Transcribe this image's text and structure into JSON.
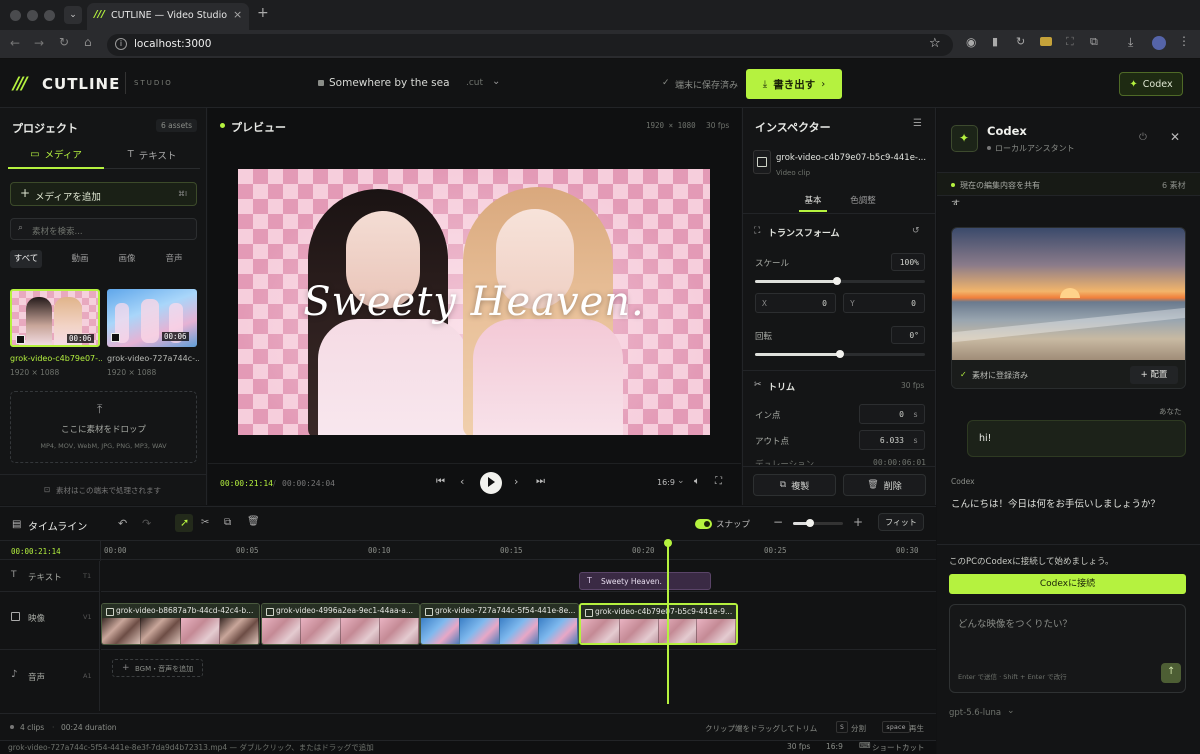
{
  "browser": {
    "tab_title": "CUTLINE — Video Studio",
    "url": "localhost:3000"
  },
  "header": {
    "brand": "CUTLINE",
    "brand_sub": "STUDIO",
    "project_name": "Somewhere by the sea",
    "project_ext": ".cut",
    "save_status": "端末に保存済み",
    "export_label": "書き出す",
    "codex_button": "Codex"
  },
  "project_panel": {
    "title": "プロジェクト",
    "asset_count": "6 assets",
    "tab_media": "メディア",
    "tab_text": "テキスト",
    "add_media": "メディアを追加",
    "add_shortcut": "⌘I",
    "search_placeholder": "素材を検索...",
    "filters": [
      "すべて",
      "動画",
      "画像",
      "音声"
    ],
    "assets": [
      {
        "name": "grok-video-c4b79e07-...",
        "duration": "00:06",
        "res": "1920 × 1088"
      },
      {
        "name": "grok-video-727a744c-...",
        "duration": "00:06",
        "res": "1920 × 1088"
      }
    ],
    "drop_title": "ここに素材をドロップ",
    "drop_formats": "MP4, MOV, WebM, JPG, PNG, MP3, WAV",
    "local_note": "素材はこの端末で処理されます"
  },
  "preview": {
    "title": "プレビュー",
    "resolution": "1920 × 1080",
    "fps": "30 fps",
    "overlay_text": "Sweety Heaven.",
    "current_time": "00:00:21:14",
    "total_time": "00:00:24:04",
    "aspect": "16:9"
  },
  "inspector": {
    "title": "インスペクター",
    "clip_name": "grok-video-c4b79e07-b5c9-441e-...",
    "clip_type": "Video clip",
    "tab_basic": "基本",
    "tab_color": "色調整",
    "transform_title": "トランスフォーム",
    "scale_label": "スケール",
    "scale_value": "100%",
    "scale_fraction": 0.48,
    "x_label": "X",
    "x_value": "0",
    "y_label": "Y",
    "y_value": "0",
    "rotate_label": "回転",
    "rotate_value": "0°",
    "rotate_fraction": 0.5,
    "trim_title": "トリム",
    "trim_fps": "30 fps",
    "in_label": "イン点",
    "in_value": "0",
    "in_unit": "s",
    "out_label": "アウト点",
    "out_value": "6.033",
    "out_unit": "s",
    "duration_label": "デュレーション",
    "duration_value": "00:00:06:01",
    "duplicate": "複製",
    "delete": "削除"
  },
  "codex": {
    "title": "Codex",
    "subtitle": "ローカルアシスタント",
    "share_label": "現在の編集内容を共有",
    "share_count": "6 素材",
    "cut_text": "す。",
    "registered": "素材に登録済み",
    "place": "配置",
    "user_label": "あなた",
    "user_msg": "hi!",
    "bot_label": "Codex",
    "bot_msg": "こんにちは！今日は何をお手伝いしましょうか？",
    "connect_prompt": "このPCのCodexに接続して始めましょう。",
    "connect_button": "Codexに接続",
    "input_placeholder": "どんな映像をつくりたい？",
    "input_hint": "Enter で送信 · Shift + Enter で改行",
    "model": "gpt-5.6-luna"
  },
  "timeline": {
    "title": "タイムライン",
    "snap_label": "スナップ",
    "fit_label": "フィット",
    "current_time": "00:00:21:14",
    "ruler": [
      "00:00",
      "00:05",
      "00:10",
      "00:15",
      "00:20",
      "00:25",
      "00:30"
    ],
    "track_text": "テキスト",
    "track_text_id": "T1",
    "track_video": "映像",
    "track_video_id": "V1",
    "track_audio": "音声",
    "track_audio_id": "A1",
    "text_clip": "Sweety Heaven.",
    "video_clips": [
      "grok-video-b8687a7b-44cd-42c4-b...",
      "grok-video-4996a2ea-9ec1-44aa-a...",
      "grok-video-727a744c-5f54-441e-8e...",
      "grok-video-c4b79e07-b5c9-441e-9..."
    ],
    "add_bgm": "BGM・音声を追加"
  },
  "status": {
    "clips": "4 clips",
    "duration": "00:24 duration",
    "trim_hint": "クリップ端をドラッグしてトリム",
    "split_key": "S",
    "split_label": "分割",
    "play_key": "space",
    "play_label": "再生",
    "file_hint": "grok-video-727a744c-5f54-441e-8e3f-7da9d4b72313.mp4 — ダブルクリック、またはドラッグで追加",
    "fps": "30 fps",
    "aspect": "16:9",
    "shortcuts": "ショートカット"
  },
  "colors": {
    "accent": "#b5f23f",
    "bg": "#111213",
    "panel": "#141516"
  }
}
